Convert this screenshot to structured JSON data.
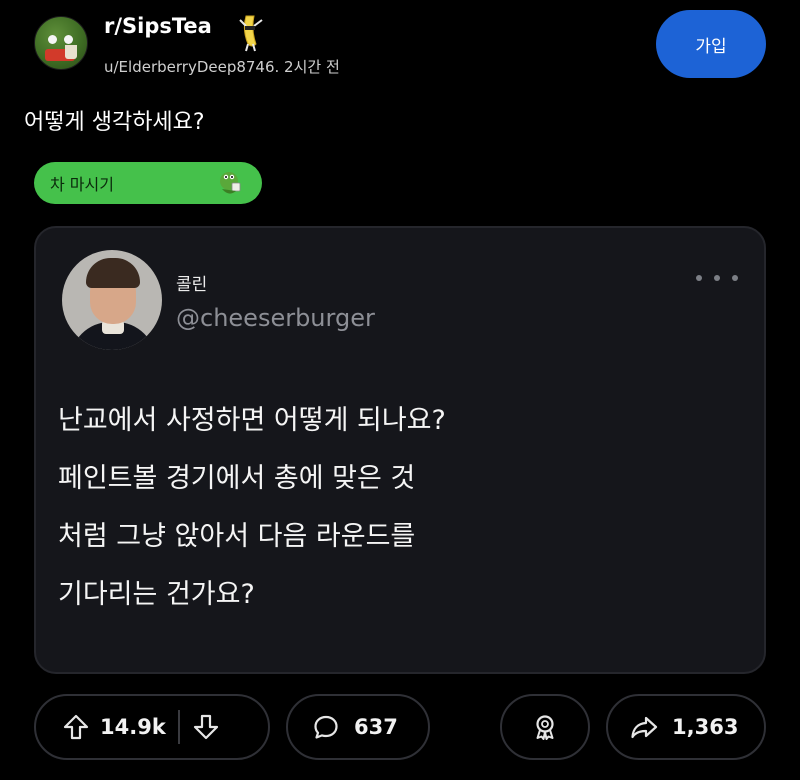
{
  "header": {
    "subreddit": "r/SipsTea",
    "byline": "u/ElderberryDeep8746. 2시간 전",
    "join_label": "가입"
  },
  "post": {
    "title": "어떻게 생각하세요?",
    "flair": "차 마시기"
  },
  "tweet": {
    "name": "콜린",
    "handle": "@cheeserburger",
    "lines": [
      "난교에서 사정하면 어떻게 되나요?",
      "페인트볼 경기에서 총에 맞은 것",
      "처럼 그냥 앉아서 다음 라운드를",
      "기다리는 건가요?"
    ]
  },
  "actions": {
    "upvotes": "14.9k",
    "comments": "637",
    "shares": "1,363"
  },
  "colors": {
    "join_button": "#1d63d6",
    "flair_bg": "#45c14b",
    "embed_bg": "#15161b"
  },
  "icons": {
    "upvote": "arrow-up-icon",
    "downvote": "arrow-down-icon",
    "comment": "speech-bubble-icon",
    "award": "award-icon",
    "share": "share-arrow-icon"
  }
}
